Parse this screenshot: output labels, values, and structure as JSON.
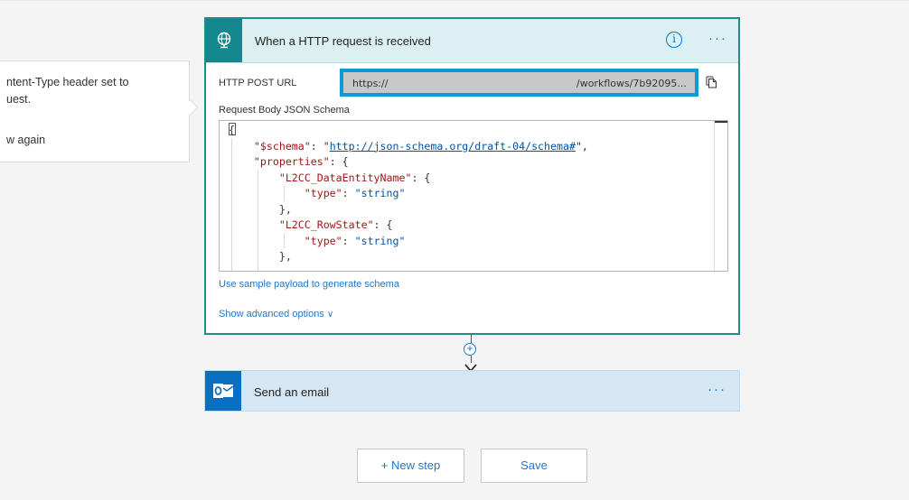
{
  "callout": {
    "line1": "ntent-Type header set to",
    "line2": "uest.",
    "line3": "w again"
  },
  "trigger": {
    "title": "When a HTTP request is received",
    "icon": "globe-icon",
    "info_glyph": "i",
    "more": "···",
    "url_label": "HTTP POST URL",
    "url_value": "https://",
    "url_suffix": "/workflows/7b92095...",
    "schema_label": "Request Body JSON Schema",
    "schema_lines": [
      "{",
      "    \"$schema\": \"http://json-schema.org/draft-04/schema#\",",
      "    \"properties\": {",
      "        \"L2CC_DataEntityName\": {",
      "            \"type\": \"string\"",
      "        },",
      "        \"L2CC_RowState\": {",
      "            \"type\": \"string\"",
      "        },"
    ],
    "sample_link": "Use sample payload to generate schema",
    "advanced_link": "Show advanced options",
    "advanced_chevron": "∨"
  },
  "connector": {
    "plus": "+"
  },
  "action": {
    "title": "Send an email",
    "icon": "outlook-icon",
    "more": "···"
  },
  "buttons": {
    "new_step": "+ New step",
    "save": "Save"
  },
  "colors": {
    "trigger_accent": "#13868e",
    "trigger_header_bg": "#dcf0f2",
    "action_accent": "#0a6ec3",
    "action_bg": "#d5e7f5",
    "link": "#2476c8",
    "url_highlight": "#0e9ad7"
  }
}
